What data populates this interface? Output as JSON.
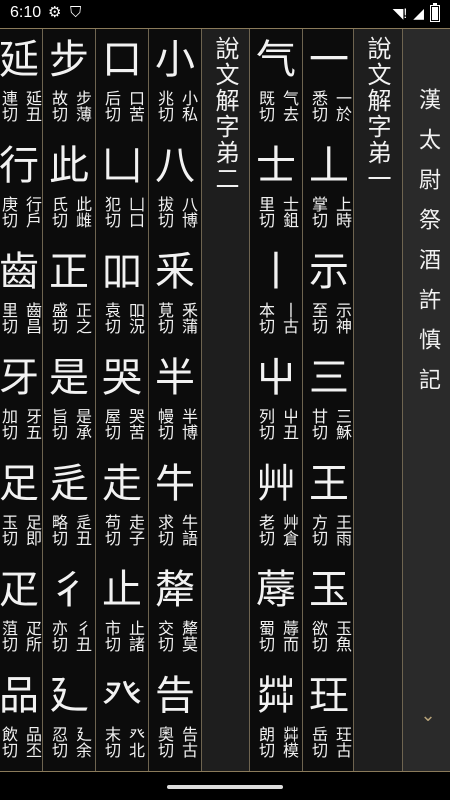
{
  "status": {
    "time": "6:10"
  },
  "sidebar": {
    "title": "漢太尉祭酒許慎記"
  },
  "chapters": [
    {
      "label": "說文解字弟一"
    },
    {
      "label": "說文解字弟二"
    }
  ],
  "columns": [
    {
      "entries": [
        {
          "glyph": "一",
          "left": "悉切",
          "right": "一於"
        },
        {
          "glyph": "丄",
          "left": "掌切",
          "right": "上時"
        },
        {
          "glyph": "示",
          "left": "至切",
          "right": "示神"
        },
        {
          "glyph": "三",
          "left": "甘切",
          "right": "三穌"
        },
        {
          "glyph": "王",
          "left": "方切",
          "right": "王雨"
        },
        {
          "glyph": "玉",
          "left": "欲切",
          "right": "玉魚"
        },
        {
          "glyph": "玨",
          "left": "岳切",
          "right": "玨古"
        }
      ]
    },
    {
      "entries": [
        {
          "glyph": "气",
          "left": "既切",
          "right": "气去"
        },
        {
          "glyph": "士",
          "left": "里切",
          "right": "士鉏"
        },
        {
          "glyph": "丨",
          "left": "本切",
          "right": "丨古"
        },
        {
          "glyph": "屮",
          "left": "列切",
          "right": "屮丑"
        },
        {
          "glyph": "艸",
          "left": "老切",
          "right": "艸倉"
        },
        {
          "glyph": "蓐",
          "left": "蜀切",
          "right": "蓐而"
        },
        {
          "glyph": "茻",
          "left": "朗切",
          "right": "茻模"
        }
      ]
    },
    {
      "entries": [
        {
          "glyph": "小",
          "left": "兆切",
          "right": "小私"
        },
        {
          "glyph": "八",
          "left": "拔切",
          "right": "八博"
        },
        {
          "glyph": "釆",
          "left": "莧切",
          "right": "釆蒲"
        },
        {
          "glyph": "半",
          "left": "幔切",
          "right": "半博"
        },
        {
          "glyph": "牛",
          "left": "求切",
          "right": "牛語"
        },
        {
          "glyph": "犛",
          "left": "交切",
          "right": "犛莫"
        },
        {
          "glyph": "告",
          "left": "奧切",
          "right": "告古"
        }
      ]
    },
    {
      "entries": [
        {
          "glyph": "口",
          "left": "后切",
          "right": "口苦"
        },
        {
          "glyph": "凵",
          "left": "犯切",
          "right": "凵口"
        },
        {
          "glyph": "吅",
          "left": "袁切",
          "right": "吅況"
        },
        {
          "glyph": "哭",
          "left": "屋切",
          "right": "哭苦"
        },
        {
          "glyph": "走",
          "left": "苟切",
          "right": "走子"
        },
        {
          "glyph": "止",
          "left": "市切",
          "right": "止諸"
        },
        {
          "glyph": "癶",
          "left": "末切",
          "right": "癶北"
        }
      ]
    },
    {
      "entries": [
        {
          "glyph": "步",
          "left": "故切",
          "right": "步薄"
        },
        {
          "glyph": "此",
          "left": "氏切",
          "right": "此雌"
        },
        {
          "glyph": "正",
          "left": "盛切",
          "right": "正之"
        },
        {
          "glyph": "是",
          "left": "旨切",
          "right": "是承"
        },
        {
          "glyph": "辵",
          "left": "略切",
          "right": "辵丑"
        },
        {
          "glyph": "彳",
          "left": "亦切",
          "right": "彳丑"
        },
        {
          "glyph": "廴",
          "left": "忍切",
          "right": "廴余"
        }
      ]
    },
    {
      "entries": [
        {
          "glyph": "延",
          "left": "連切",
          "right": "延丑"
        },
        {
          "glyph": "行",
          "left": "庚切",
          "right": "行戶"
        },
        {
          "glyph": "齒",
          "left": "里切",
          "right": "齒昌"
        },
        {
          "glyph": "牙",
          "left": "加切",
          "right": "牙五"
        },
        {
          "glyph": "足",
          "left": "玉切",
          "right": "足即"
        },
        {
          "glyph": "疋",
          "left": "菹切",
          "right": "疋所"
        },
        {
          "glyph": "品",
          "left": "飲切",
          "right": "品丕"
        }
      ]
    }
  ]
}
